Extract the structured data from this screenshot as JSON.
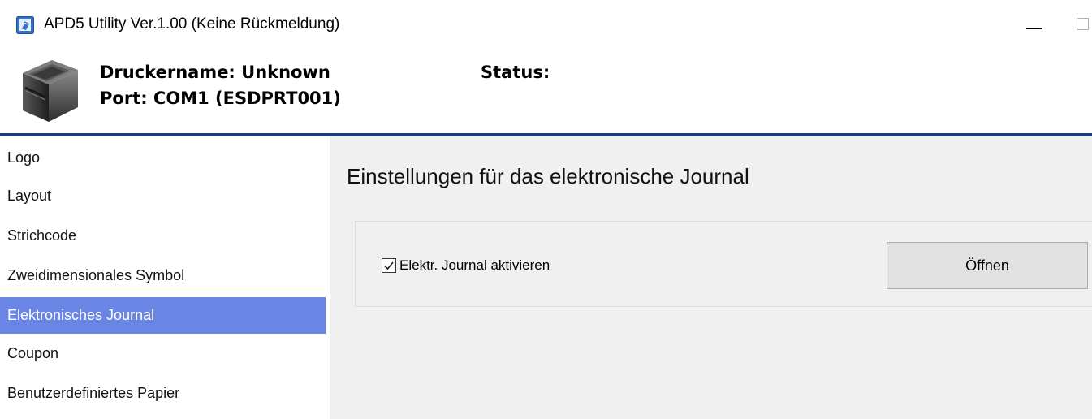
{
  "window": {
    "title": "APD5 Utility Ver.1.00 (Keine Rückmeldung)",
    "app_icon": "apd-utility-icon",
    "controls": [
      "minimize-icon",
      "maximize-icon"
    ]
  },
  "header": {
    "printer_name_line": "Druckername: Unknown",
    "port_line": "Port: COM1 (ESDPRT001)",
    "status_label": "Status:",
    "printer_icon": "receipt-printer-icon",
    "divider_color": "#1f3a79"
  },
  "sidebar": {
    "items": [
      {
        "label": "Logo"
      },
      {
        "label": "Layout"
      },
      {
        "label": "Strichcode"
      },
      {
        "label": "Zweidimensionales Symbol"
      },
      {
        "label": "Elektronisches Journal"
      },
      {
        "label": "Coupon"
      },
      {
        "label": "Benutzerdefiniertes Papier"
      }
    ],
    "active_index": 4,
    "active_color": "#6a86e4"
  },
  "main": {
    "title": "Einstellungen für das elektronische Journal",
    "checkbox": {
      "label": "Elektr. Journal aktivieren",
      "checked": true
    },
    "open_button_label": "Öffnen"
  }
}
